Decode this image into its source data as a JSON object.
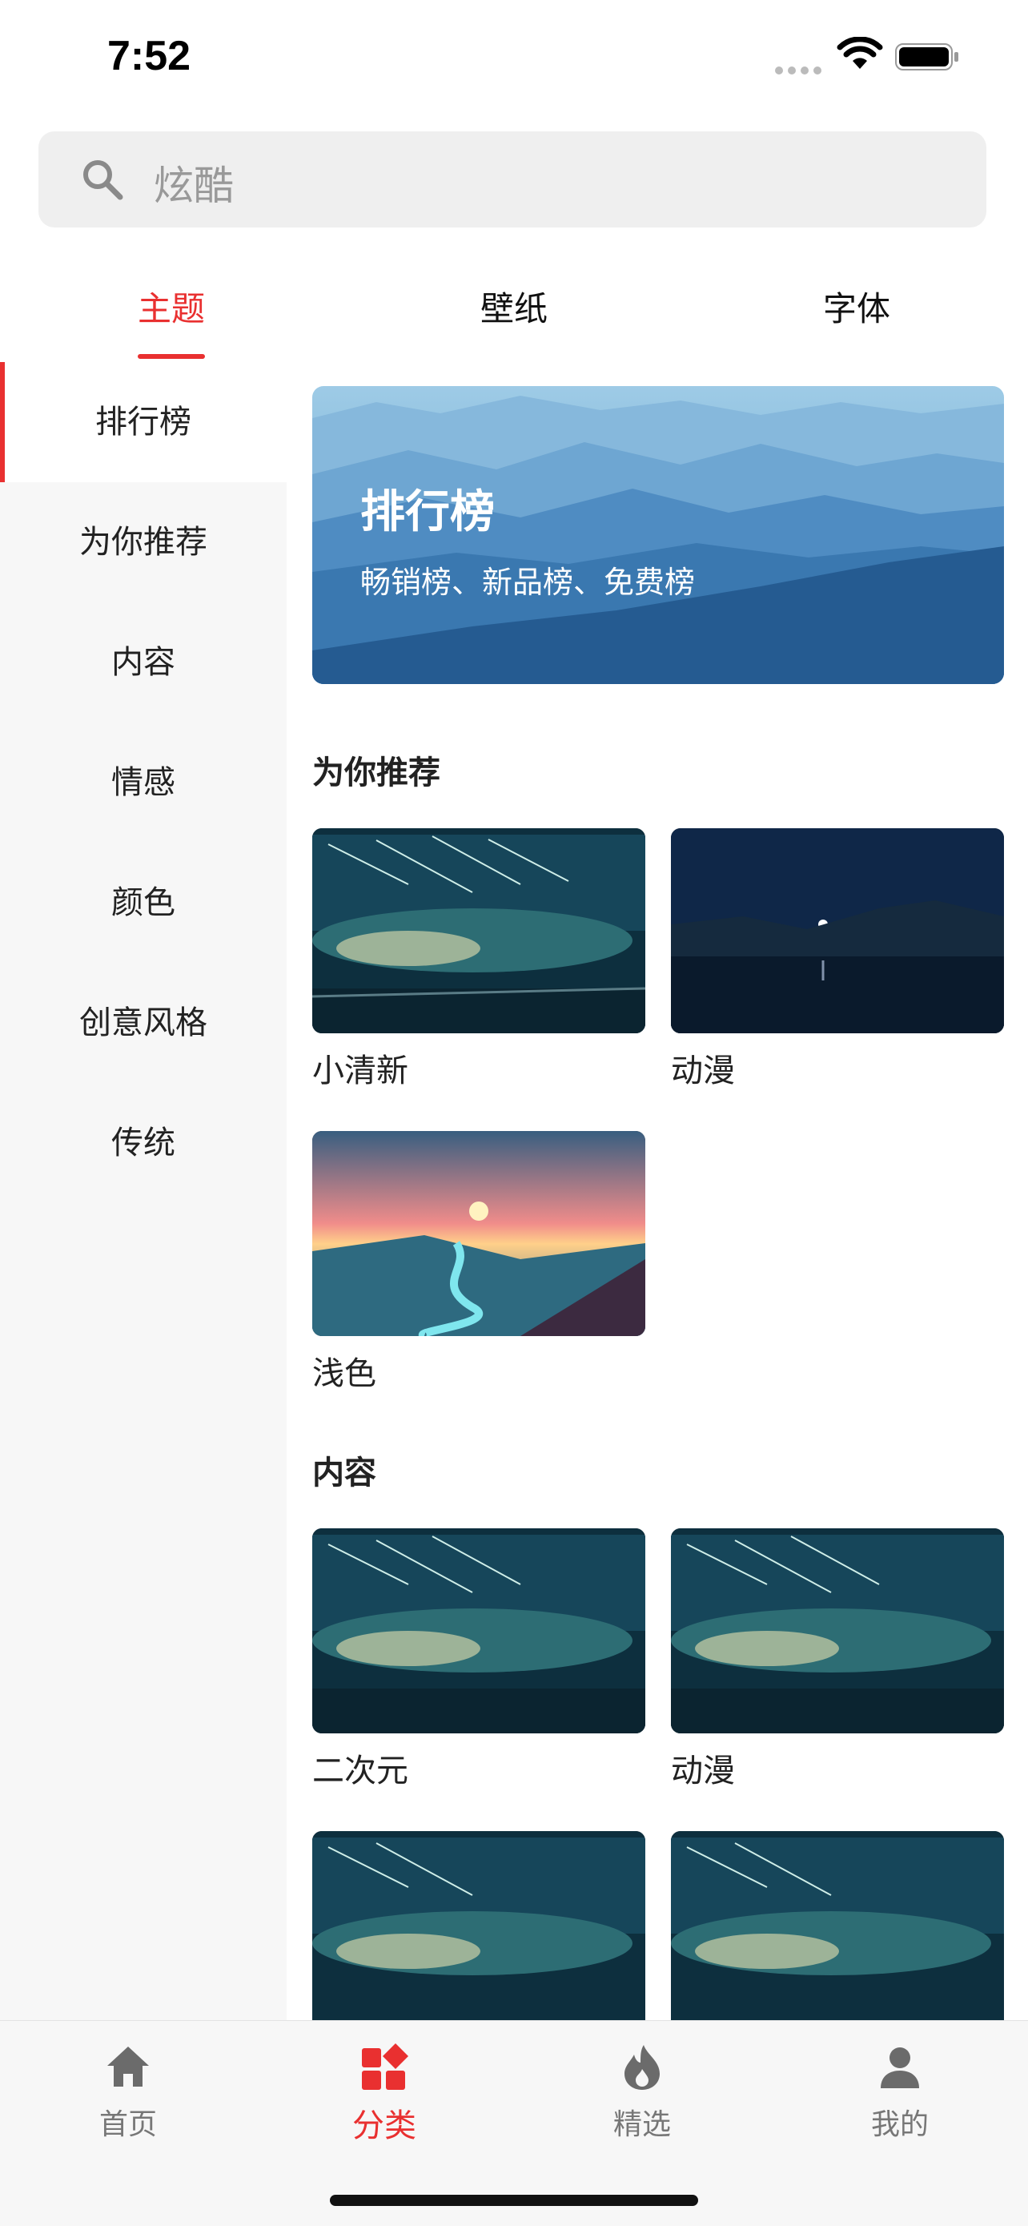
{
  "status": {
    "time": "7:52"
  },
  "search": {
    "text": "炫酷"
  },
  "tabs": [
    {
      "label": "主题",
      "active": true
    },
    {
      "label": "壁纸",
      "active": false
    },
    {
      "label": "字体",
      "active": false
    }
  ],
  "sidebar": {
    "items": [
      {
        "label": "排行榜",
        "active": true
      },
      {
        "label": "为你推荐"
      },
      {
        "label": "内容"
      },
      {
        "label": "情感"
      },
      {
        "label": "颜色"
      },
      {
        "label": "创意风格"
      },
      {
        "label": "传统"
      }
    ]
  },
  "banner": {
    "title": "排行榜",
    "subtitle": "畅销榜、新品榜、免费榜"
  },
  "sections": {
    "recommend": {
      "title": "为你推荐",
      "items": [
        {
          "label": "小清新",
          "image": "meteor-sky"
        },
        {
          "label": "动漫",
          "image": "night-lake"
        },
        {
          "label": "浅色",
          "image": "sunset-river"
        }
      ]
    },
    "content": {
      "title": "内容",
      "items": [
        {
          "label": "二次元",
          "image": "meteor-sky"
        },
        {
          "label": "动漫",
          "image": "meteor-sky"
        },
        {
          "label": "",
          "image": "meteor-sky"
        },
        {
          "label": "",
          "image": "meteor-sky"
        }
      ]
    }
  },
  "bottom_nav": [
    {
      "label": "首页",
      "icon": "home-icon"
    },
    {
      "label": "分类",
      "icon": "category-icon",
      "active": true
    },
    {
      "label": "精选",
      "icon": "flame-icon"
    },
    {
      "label": "我的",
      "icon": "user-icon"
    }
  ],
  "colors": {
    "accent": "#e93030",
    "sidebar_bg": "#f7f7f7",
    "search_bg": "#efefef"
  }
}
